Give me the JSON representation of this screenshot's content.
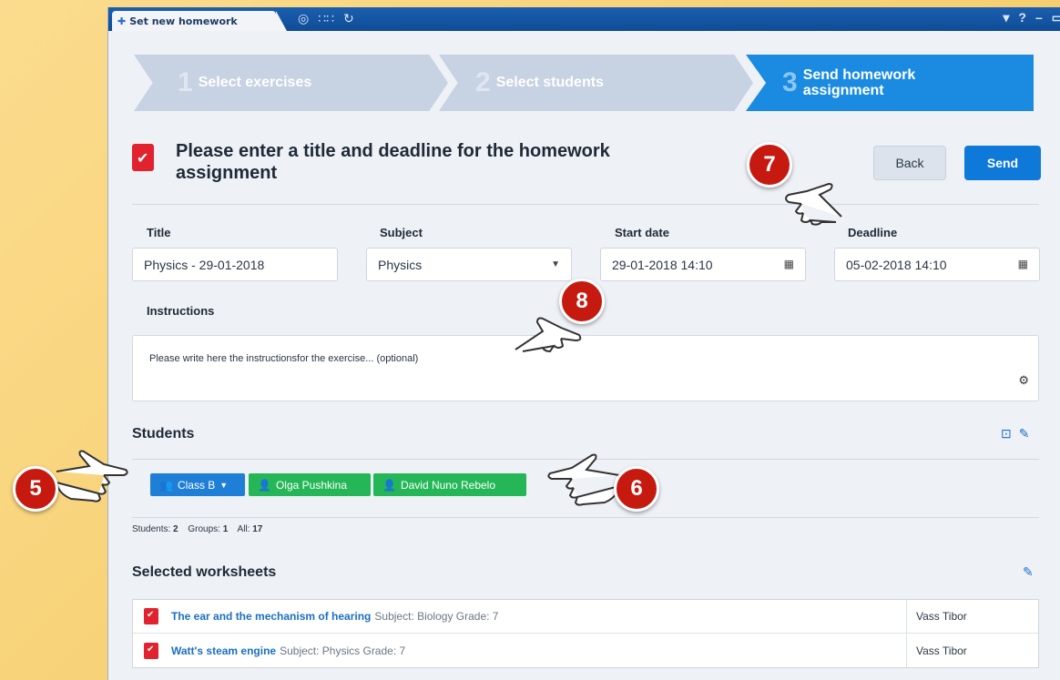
{
  "window": {
    "tab_title": "Set new homework",
    "toolbar_icons": [
      "palette-icon",
      "grid-icon",
      "refresh-icon"
    ],
    "controls": [
      "dropdown-icon",
      "help-icon",
      "minimize-icon",
      "maximize-icon"
    ]
  },
  "steps": [
    {
      "num": "1",
      "label": "Select exercises",
      "active": false
    },
    {
      "num": "2",
      "label": "Select students",
      "active": false
    },
    {
      "num": "3",
      "label": "Send homework assignment",
      "active": true
    }
  ],
  "header": {
    "title": "Please enter a title and deadline for the homework assignment",
    "back_label": "Back",
    "send_label": "Send"
  },
  "form": {
    "title_label": "Title",
    "title_value": "Physics - 29-01-2018",
    "subject_label": "Subject",
    "subject_value": "Physics",
    "start_label": "Start date",
    "start_value": "29-01-2018 14:10",
    "deadline_label": "Deadline",
    "deadline_value": "05-02-2018 14:10",
    "instructions_label": "Instructions",
    "instructions_value": "Please write here the instructionsfor the exercise... (optional)"
  },
  "students": {
    "title": "Students",
    "chips": [
      {
        "label": "Class B",
        "type": "group"
      },
      {
        "label": "Olga Pushkina",
        "type": "student"
      },
      {
        "label": "David Nuno Rebelo",
        "type": "student"
      }
    ],
    "counts": {
      "students_label": "Students:",
      "students_value": "2",
      "groups_label": "Groups:",
      "groups_value": "1",
      "all_label": "All:",
      "all_value": "17"
    }
  },
  "worksheets": {
    "title": "Selected worksheets",
    "rows": [
      {
        "title": "The ear and the mechanism of hearing",
        "meta": "Subject: Biology Grade: 7",
        "author": "Vass Tibor"
      },
      {
        "title": "Watt's steam engine",
        "meta": "Subject: Physics Grade: 7",
        "author": "Vass Tibor"
      }
    ]
  },
  "callouts": [
    "5",
    "6",
    "7",
    "8"
  ],
  "colors": {
    "accent": "#0f79d9",
    "green_chip": "#25b757",
    "callout_red": "#c61a10",
    "background": "#f8d37a"
  }
}
